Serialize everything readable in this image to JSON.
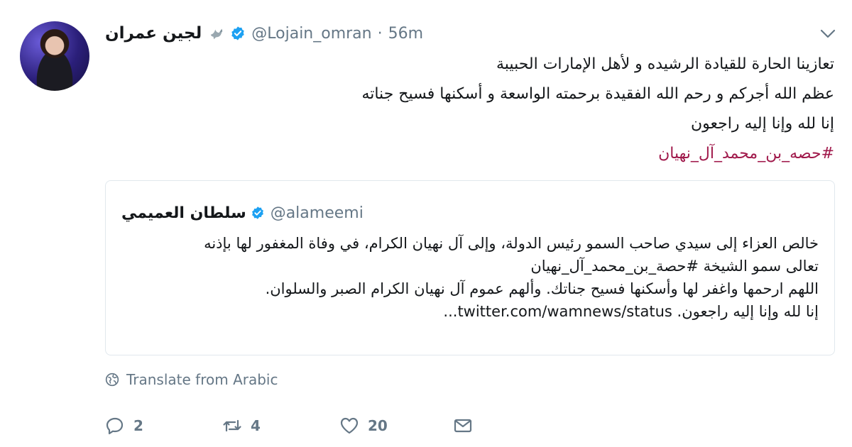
{
  "author": {
    "display_name": "لجين عمران",
    "handle": "@Lojain_omran",
    "separator": "·",
    "time": "56m"
  },
  "tweet": {
    "lines": [
      "تعازينا الحارة للقيادة الرشيده و لأهل الإمارات الحبيبة",
      "عظم الله أجركم و رحم الله الفقيدة برحمته الواسعة و أسكنها فسيح جناته",
      "إنا لله وإنا إليه راجعون"
    ],
    "hashtag": "#حصه_بن_محمد_آل_نهيان"
  },
  "quoted_tweet": {
    "display_name": "سلطان العميمي",
    "handle": "@alameemi",
    "lines": [
      "خالص العزاء إلى سيدي صاحب السمو رئيس الدولة، وإلى آل نهيان الكرام، في وفاة المغفور لها بإذنه",
      "تعالى سمو الشيخة #حصة_بن_محمد_آل_نهيان",
      "اللهم ارحمها واغفر لها وأسكنها فسيح جناتك. وألهم عموم آل نهيان الكرام الصبر والسلوان.",
      "إنا لله وإنا إليه راجعون."
    ],
    "link": "twitter.com/wamnews/status..."
  },
  "translate": {
    "label": "Translate from Arabic"
  },
  "actions": {
    "reply_count": "2",
    "retweet_count": "4",
    "like_count": "20"
  },
  "colors": {
    "verified": "#1da1f2",
    "hashtag": "#a0194b",
    "secondary_text": "#657786",
    "border": "#e1e8ed"
  },
  "icons": [
    "avatar",
    "dove-icon",
    "verified-icon",
    "chevron-down-icon",
    "globe-icon",
    "reply-icon",
    "retweet-icon",
    "like-icon",
    "message-icon"
  ]
}
